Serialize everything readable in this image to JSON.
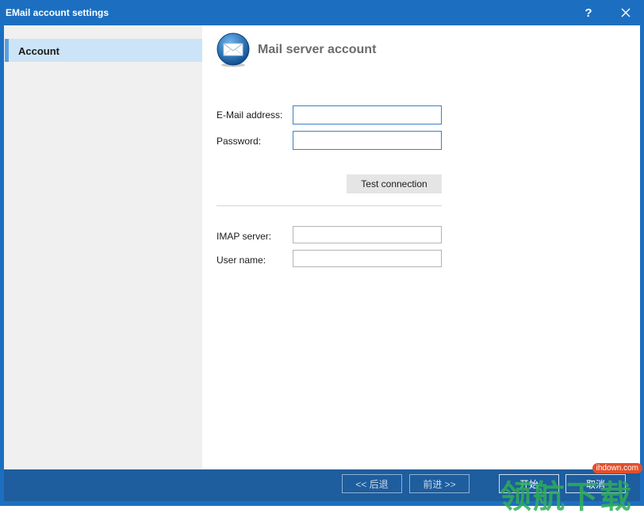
{
  "window": {
    "title": "EMail account settings",
    "help_label": "?",
    "close_icon": "close-icon"
  },
  "sidebar": {
    "items": [
      {
        "label": "Account",
        "selected": true
      }
    ]
  },
  "main": {
    "icon": "mail-envelope-icon",
    "title": "Mail server account",
    "fields": {
      "email": {
        "label": "E-Mail address:",
        "value": ""
      },
      "password": {
        "label": "Password:",
        "value": ""
      },
      "imap": {
        "label": "IMAP server:",
        "value": ""
      },
      "username": {
        "label": "User name:",
        "value": ""
      }
    },
    "test_button": "Test connection"
  },
  "footer": {
    "back": "<< 后退",
    "next": "前进 >>",
    "start": "开始",
    "cancel": "取消"
  },
  "watermark": {
    "domain": "ihdown.com",
    "brand": "领航下载"
  },
  "colors": {
    "titlebar": "#1c6fc0",
    "footer": "#1e5d9e",
    "sidebar_selected": "#cce4f7",
    "sidebar_accent": "#5aa0e0"
  }
}
